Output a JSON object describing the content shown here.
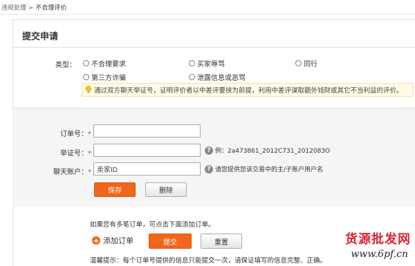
{
  "breadcrumb": {
    "parent": "违规处理",
    "separator": ">",
    "current": "不合理评价"
  },
  "page_title": "提交申请",
  "type_field": {
    "label": "类型：",
    "options": [
      "不合理要求",
      "买家辱骂",
      "同行",
      "第三方诈骗",
      "泄露信息或恶骂"
    ]
  },
  "notice": "通过双方聊天举证号，证明评价者以中差评要挟为前提，利用中差评谋取额外钱财或其它不当利益的评价。",
  "form": {
    "order_label": "订单号：",
    "required_mark": "*",
    "order_value": "",
    "proof_label": "举证号：",
    "proof_value": "",
    "proof_hint": "例：2a473861_2012C731_2012083O",
    "chat_label": "聊天账户：",
    "chat_value": "卖家ID",
    "chat_hint": "请您提供您该交易中的主/子账户用户名",
    "save_label": "保存",
    "delete_label": "删除"
  },
  "bottom": {
    "multi_order_tip": "如果您有多笔订单，可点击下面添加订单。",
    "add_order_label": "添加订单",
    "submit_label": "提交",
    "reset_label": "重置",
    "footer_tip": "温馨提示：每个订单号提供的信息只能提交一次，请保证填写的信息完整、正确。"
  },
  "watermark": {
    "line1": "货源批发网",
    "line2": "www.6pf.cn"
  },
  "colors": {
    "accent": "#f2661c",
    "required": "#e4393c",
    "notice_bg": "#fffbe5"
  },
  "icons": {
    "help": "question-circle-icon",
    "bulb": "lightbulb-icon",
    "add": "plus-circle-icon"
  }
}
